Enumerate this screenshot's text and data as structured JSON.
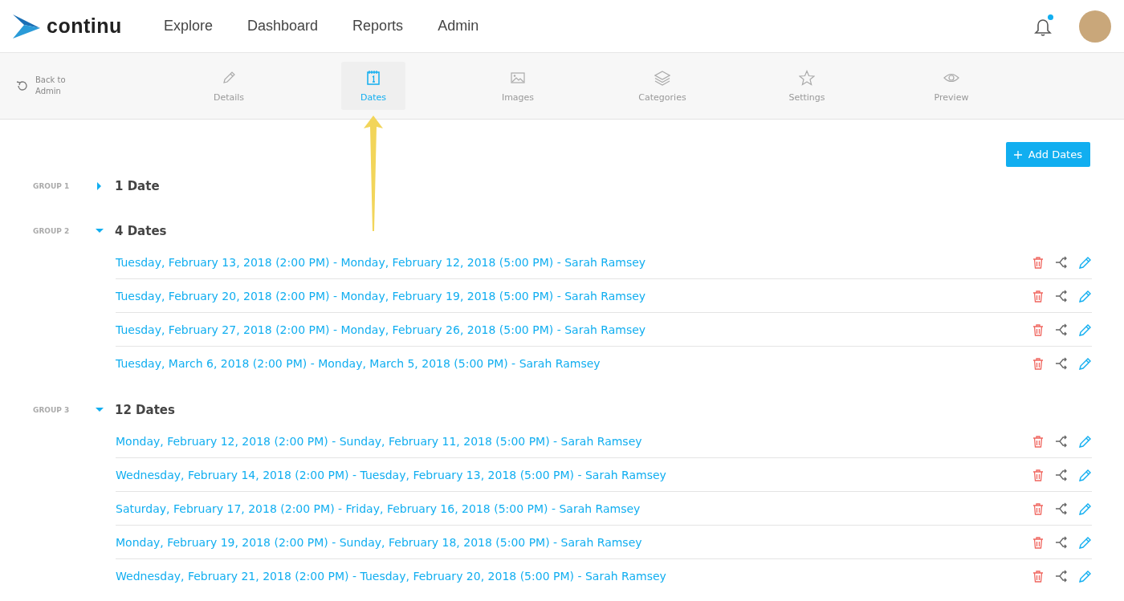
{
  "header": {
    "brand": "continu",
    "nav": [
      {
        "label": "Explore"
      },
      {
        "label": "Dashboard"
      },
      {
        "label": "Reports"
      },
      {
        "label": "Admin"
      }
    ],
    "notifications": {
      "unread": true
    }
  },
  "subnav": {
    "back": "Back to Admin",
    "tabs": [
      {
        "label": "Details",
        "selected": false
      },
      {
        "label": "Dates",
        "selected": true
      },
      {
        "label": "Images",
        "selected": false
      },
      {
        "label": "Categories",
        "selected": false
      },
      {
        "label": "Settings",
        "selected": false
      },
      {
        "label": "Preview",
        "selected": false
      }
    ]
  },
  "add_button": "Add Dates",
  "groups": [
    {
      "label": "GROUP 1",
      "title": "1 Date",
      "expanded": false
    },
    {
      "label": "GROUP 2",
      "title": "4 Dates",
      "expanded": true,
      "dates": [
        "Tuesday, February 13, 2018 (2:00 PM) - Monday, February 12, 2018 (5:00 PM) - Sarah Ramsey",
        "Tuesday, February 20, 2018 (2:00 PM) - Monday, February 19, 2018 (5:00 PM) - Sarah Ramsey",
        "Tuesday, February 27, 2018 (2:00 PM) - Monday, February 26, 2018 (5:00 PM) - Sarah Ramsey",
        "Tuesday, March 6, 2018 (2:00 PM) - Monday, March 5, 2018 (5:00 PM) - Sarah Ramsey"
      ]
    },
    {
      "label": "GROUP 3",
      "title": "12 Dates",
      "expanded": true,
      "dates": [
        "Monday, February 12, 2018 (2:00 PM) - Sunday, February 11, 2018 (5:00 PM) - Sarah Ramsey",
        "Wednesday, February 14, 2018 (2:00 PM) - Tuesday, February 13, 2018 (5:00 PM) - Sarah Ramsey",
        "Saturday, February 17, 2018 (2:00 PM) - Friday, February 16, 2018 (5:00 PM) - Sarah Ramsey",
        "Monday, February 19, 2018 (2:00 PM) - Sunday, February 18, 2018 (5:00 PM) - Sarah Ramsey",
        "Wednesday, February 21, 2018 (2:00 PM) - Tuesday, February 20, 2018 (5:00 PM) - Sarah Ramsey"
      ]
    }
  ]
}
